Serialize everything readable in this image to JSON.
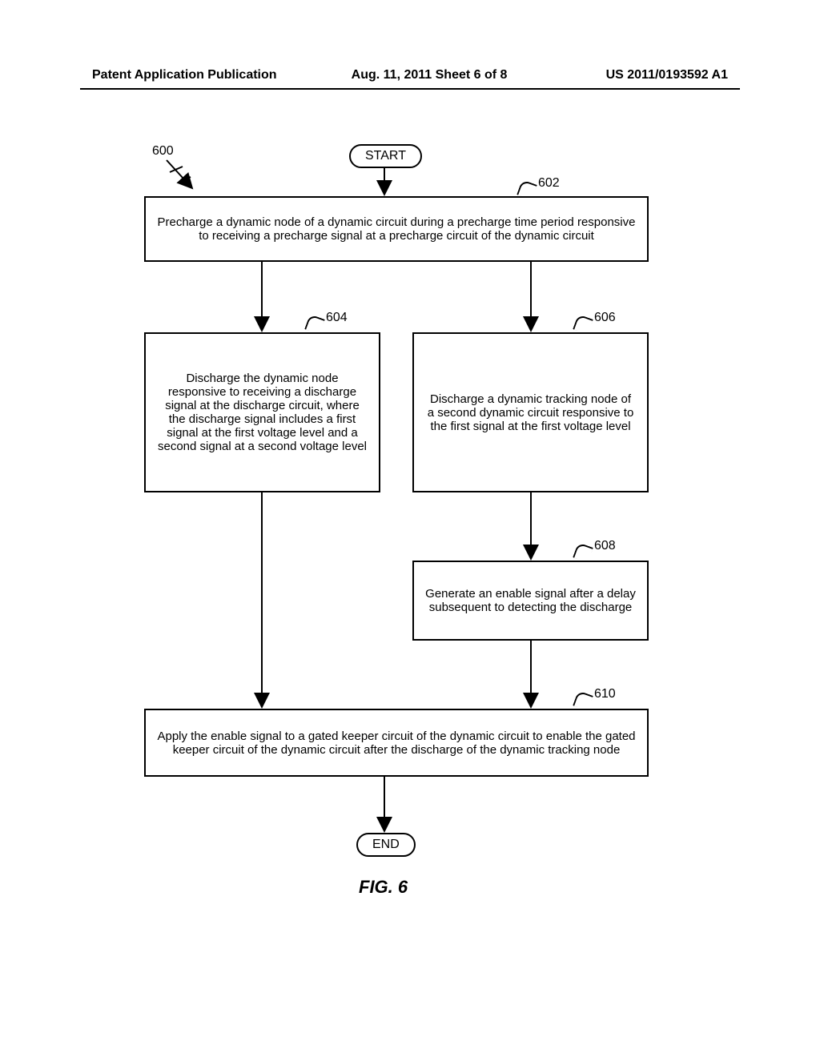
{
  "header": {
    "left": "Patent Application Publication",
    "center": "Aug. 11, 2011  Sheet 6 of 8",
    "right": "US 2011/0193592 A1"
  },
  "flowchart": {
    "ref_number": "600",
    "start": "START",
    "end": "END",
    "steps": {
      "602": "Precharge a dynamic node of a dynamic circuit during a precharge time period responsive to receiving a precharge signal at a precharge circuit of the dynamic circuit",
      "604": "Discharge the dynamic node responsive to receiving a discharge signal at the discharge circuit, where the discharge signal includes a first signal at the first voltage level and a second signal at a second voltage level",
      "606": "Discharge a dynamic tracking node of a second dynamic circuit responsive to the first signal at the first voltage level",
      "608": "Generate an enable signal after a delay subsequent to detecting the discharge",
      "610": "Apply the enable signal to a gated keeper circuit of the dynamic circuit to enable the gated keeper circuit of the dynamic circuit after the discharge of the dynamic tracking node"
    },
    "labels": {
      "l602": "602",
      "l604": "604",
      "l606": "606",
      "l608": "608",
      "l610": "610"
    }
  },
  "figure_label": "FIG. 6"
}
